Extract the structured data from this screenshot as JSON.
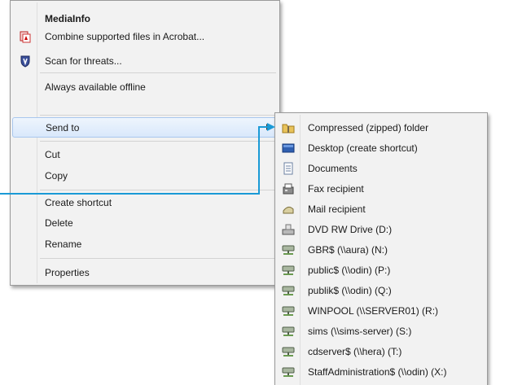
{
  "context_menu": {
    "items": [
      {
        "label": "MediaInfo"
      },
      {
        "label": "Combine supported files in Acrobat..."
      },
      {
        "label": "Scan for threats..."
      },
      {
        "label": "Always available offline"
      },
      {
        "label": "Send to"
      },
      {
        "label": "Cut"
      },
      {
        "label": "Copy"
      },
      {
        "label": "Create shortcut"
      },
      {
        "label": "Delete"
      },
      {
        "label": "Rename"
      },
      {
        "label": "Properties"
      }
    ]
  },
  "send_to_menu": {
    "items": [
      {
        "label": "Compressed (zipped) folder"
      },
      {
        "label": "Desktop (create shortcut)"
      },
      {
        "label": "Documents"
      },
      {
        "label": "Fax recipient"
      },
      {
        "label": "Mail recipient"
      },
      {
        "label": "DVD RW Drive (D:)"
      },
      {
        "label": "GBR$ (\\\\aura) (N:)"
      },
      {
        "label": "public$ (\\\\odin) (P:)"
      },
      {
        "label": "publik$ (\\\\odin) (Q:)"
      },
      {
        "label": "WINPOOL (\\\\SERVER01) (R:)"
      },
      {
        "label": "sims (\\\\sims-server) (S:)"
      },
      {
        "label": "cdserver$ (\\\\hera) (T:)"
      },
      {
        "label": "StaffAdministration$ (\\\\odin) (X:)"
      }
    ]
  },
  "colors": {
    "callout": "#1a9ad6",
    "highlight": "#d9e8fb"
  }
}
